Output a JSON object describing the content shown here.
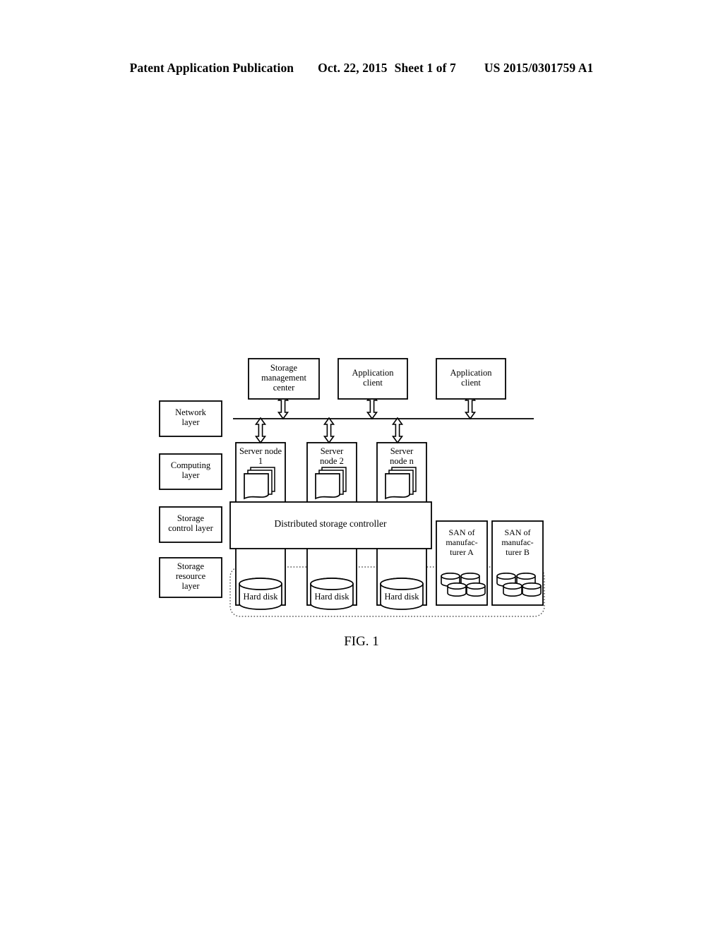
{
  "page_header": {
    "publication": "Patent Application Publication",
    "date": "Oct. 22, 2015",
    "sheet": "Sheet 1 of 7",
    "publication_number": "US 2015/0301759 A1"
  },
  "figure": {
    "caption": "FIG. 1",
    "layer_labels": [
      {
        "id": "network-layer",
        "lines": [
          "Network",
          "layer"
        ]
      },
      {
        "id": "computing-layer",
        "lines": [
          "Computing",
          "layer"
        ]
      },
      {
        "id": "storage-control-layer",
        "lines": [
          "Storage",
          "control layer"
        ]
      },
      {
        "id": "storage-resource-layer",
        "lines": [
          "Storage",
          "resource",
          "layer"
        ]
      }
    ],
    "network_nodes": [
      {
        "id": "storage-management-center",
        "lines": [
          "Storage",
          "management",
          "center"
        ]
      },
      {
        "id": "application-client-1",
        "lines": [
          "Application",
          "client"
        ]
      },
      {
        "id": "application-client-2",
        "lines": [
          "Application",
          "client"
        ]
      }
    ],
    "server_nodes": [
      {
        "id": "server-node-1",
        "lines": [
          "Server node",
          "1"
        ]
      },
      {
        "id": "server-node-2",
        "lines": [
          "Server",
          "node 2"
        ]
      },
      {
        "id": "server-node-n",
        "lines": [
          "Server",
          "node n"
        ]
      }
    ],
    "controller": {
      "id": "distributed-storage-controller",
      "label": "Distributed storage controller"
    },
    "san_boxes": [
      {
        "id": "san-manufacturer-a",
        "lines": [
          "SAN of",
          "manufac-",
          "turer A"
        ]
      },
      {
        "id": "san-manufacturer-b",
        "lines": [
          "SAN of",
          "manufac-",
          "turer B"
        ]
      }
    ],
    "hard_disks": [
      {
        "id": "hard-disk-1",
        "label": "Hard disk"
      },
      {
        "id": "hard-disk-2",
        "label": "Hard disk"
      },
      {
        "id": "hard-disk-3",
        "label": "Hard disk"
      }
    ],
    "colors": {
      "stroke": "#000000",
      "background": "#ffffff",
      "dotted_boundary": "#555555"
    }
  }
}
